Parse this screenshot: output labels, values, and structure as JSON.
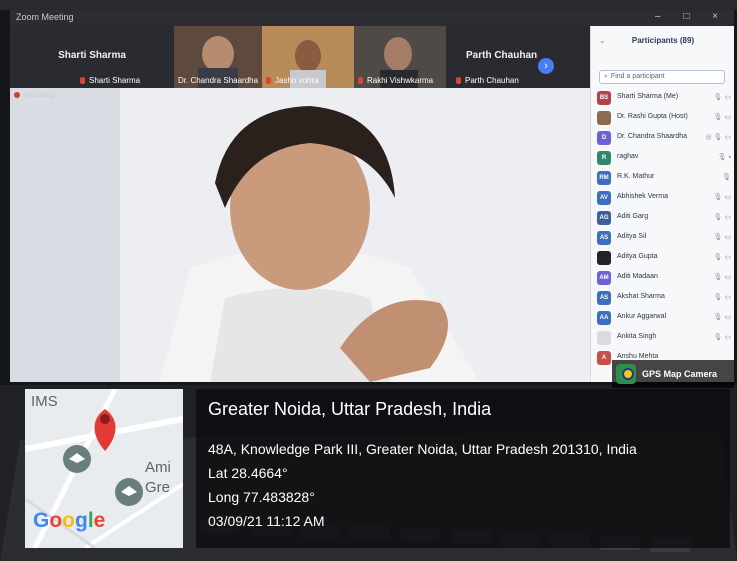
{
  "meeting": {
    "app_title": "Zoom Meeting",
    "recording_label": "Recording",
    "window_controls": "– □ ×",
    "tiles": [
      {
        "label": "Sharti Sharma",
        "big_label": "Sharti Sharma"
      },
      {
        "label": "Dr. Chandra Shaardha",
        "big_label": ""
      },
      {
        "label": "Jashn vohra",
        "big_label": ""
      },
      {
        "label": "Rakhi Vishwkarma",
        "big_label": ""
      },
      {
        "label": "Parth Chauhan",
        "big_label": "Parth Chauhan"
      }
    ],
    "next_arrow": "›"
  },
  "participants": {
    "header": "Participants (89)",
    "collapse_icon": "⌄",
    "search_placeholder": "Find a participant",
    "list": [
      {
        "initials": "BS",
        "name": "Sharti Sharma (Me)",
        "color": "#b6424b",
        "icons": "🎙 ▭"
      },
      {
        "initials": "",
        "name": "Dr. Rashi Gupta (Host)",
        "color": "#8d6b52",
        "icons": "🎙 ▭"
      },
      {
        "initials": "D",
        "name": "Dr. Chandra Shaardha",
        "color": "#6c63d9",
        "icons": "◎ 🎙 ▭"
      },
      {
        "initials": "R",
        "name": "raghav",
        "color": "#2f8a6a",
        "icons": "🎙 ▪"
      },
      {
        "initials": "RM",
        "name": "R.K. Mathur",
        "color": "#3d6fbf",
        "icons": "🎙"
      },
      {
        "initials": "AV",
        "name": "Abhishek Verma",
        "color": "#3d6fbf",
        "icons": "🎙 ▭"
      },
      {
        "initials": "AG",
        "name": "Aditi Garg",
        "color": "#3f5f9e",
        "icons": "🎙 ▭"
      },
      {
        "initials": "AS",
        "name": "Aditya Sil",
        "color": "#3d6fbf",
        "icons": "🎙 ▭"
      },
      {
        "initials": "",
        "name": "Aditya Gupta",
        "color": "#222428",
        "icons": "🎙 ▭"
      },
      {
        "initials": "AM",
        "name": "Aditi Madaan",
        "color": "#6c63d9",
        "icons": "🎙 ▭"
      },
      {
        "initials": "AS",
        "name": "Akshat Sharma",
        "color": "#3d6fbf",
        "icons": "🎙 ▭"
      },
      {
        "initials": "AA",
        "name": "Ankur Aggarwal",
        "color": "#3d6fbf",
        "icons": "🎙 ▭"
      },
      {
        "initials": "",
        "name": "Ankita Singh",
        "color": "#d9dbe0",
        "icons": "🎙 ▭"
      },
      {
        "initials": "A",
        "name": "Anshu Mehta",
        "color": "#c9504a",
        "icons": ""
      }
    ]
  },
  "overlay": {
    "badge_label": "GPS Map Camera",
    "place": "Greater Noida, Uttar Pradesh, India",
    "address": "48A, Knowledge Park III, Greater Noida, Uttar Pradesh 201310, India",
    "lat": "Lat 28.4664°",
    "long": "Long 77.483828°",
    "datetime": "03/09/21 11:12 AM",
    "map_labels": {
      "top": "IMS",
      "right1": "Ami",
      "right2": "Gre"
    },
    "google_logo": [
      "G",
      "o",
      "o",
      "g",
      "l",
      "e"
    ],
    "google_colors": [
      "#4285f4",
      "#ea4335",
      "#fbbc05",
      "#4285f4",
      "#34a853",
      "#ea4335"
    ]
  }
}
